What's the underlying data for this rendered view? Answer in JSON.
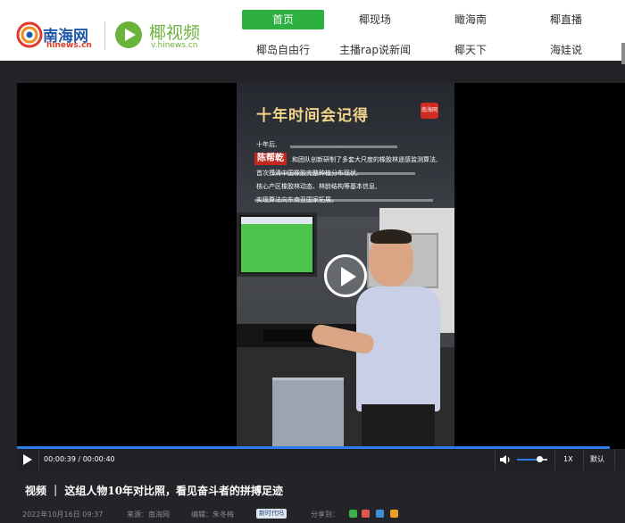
{
  "header": {
    "logo1": {
      "name": "南海网",
      "sub": "hinews.cn"
    },
    "logo2": {
      "name": "椰视频",
      "sub": "v.hinews.cn"
    }
  },
  "nav": {
    "row1": [
      {
        "label": "首页",
        "active": true
      },
      {
        "label": "椰现场",
        "active": false
      },
      {
        "label": "瞰海南",
        "active": false
      },
      {
        "label": "椰直播",
        "active": false
      }
    ],
    "row2": [
      {
        "label": "椰岛自由行"
      },
      {
        "label": "主播rap说新闻"
      },
      {
        "label": "椰天下"
      },
      {
        "label": "海娃说"
      }
    ]
  },
  "video": {
    "caption_title": "十年时间会记得",
    "caption_badge": "南海网",
    "caption_lines": [
      "十年后,",
      "和团队创新研制了多套大尺度的橡胶林遥感监测算法,",
      "首次摸清中国橡胶完整种植分布现状,",
      "核心产区橡胶林动态、林龄结构等基本信息,",
      "实现算法向东南亚国家拓展。"
    ],
    "caption_name": "陈帮乾",
    "current_time": "00:00:39",
    "duration": "00:00:40",
    "progress": 0.975,
    "volume": 0.75,
    "speed": "1X",
    "quality": "默认"
  },
  "article": {
    "title": "视频 ｜ 这组人物10年对比照，看见奋斗者的拼搏足迹",
    "date": "2022年10月16日 09:37",
    "source": "来源：南海网",
    "editor": "编辑：朱冬梅",
    "tag": "新时代吗",
    "share_label": "分享到："
  },
  "colors": {
    "nav_active": "#2db040",
    "brand_blue": "#1d58a6",
    "brand_green": "#6cb33e",
    "progress": "#2f7ce8"
  }
}
